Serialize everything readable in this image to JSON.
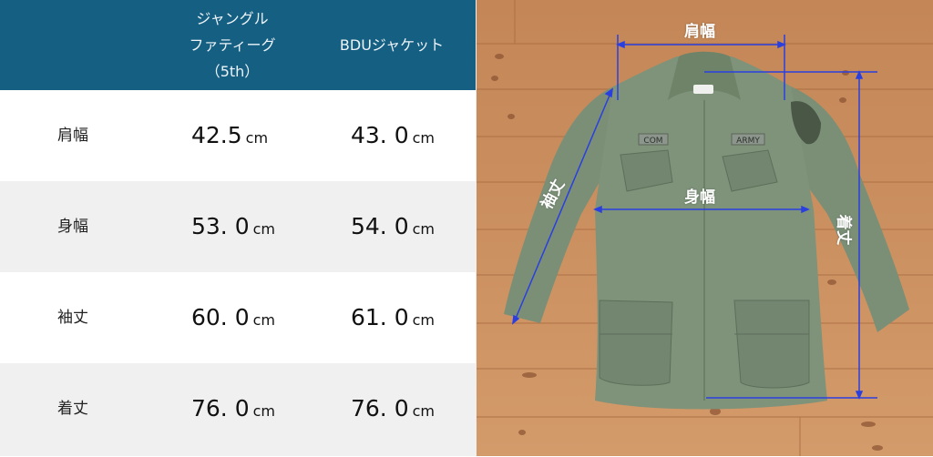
{
  "table": {
    "header": {
      "col1": [
        "ジャングル",
        "ファティーグ",
        "（5th）"
      ],
      "col2": "BDUジャケット"
    },
    "unit": "cm",
    "rows": [
      {
        "label": "肩幅",
        "jungle": "42.5",
        "bdu": "43. 0"
      },
      {
        "label": "身幅",
        "jungle": "53. 0",
        "bdu": "54. 0"
      },
      {
        "label": "袖丈",
        "jungle": "60. 0",
        "bdu": "61. 0"
      },
      {
        "label": "着丈",
        "jungle": "76. 0",
        "bdu": "76. 0"
      }
    ]
  },
  "photo": {
    "annotations": {
      "shoulder": "肩幅",
      "body": "身幅",
      "sleeve": "袖丈",
      "length": "着丈"
    },
    "patches": {
      "name_tape_left": "COM",
      "name_tape_right": "ARMY"
    }
  },
  "colors": {
    "header_bg": "#155f83",
    "row_alt": "#f0f0f0",
    "measure_line": "#2a3fe0",
    "jacket": "#7a8f76",
    "wood": "#c98a5a"
  }
}
